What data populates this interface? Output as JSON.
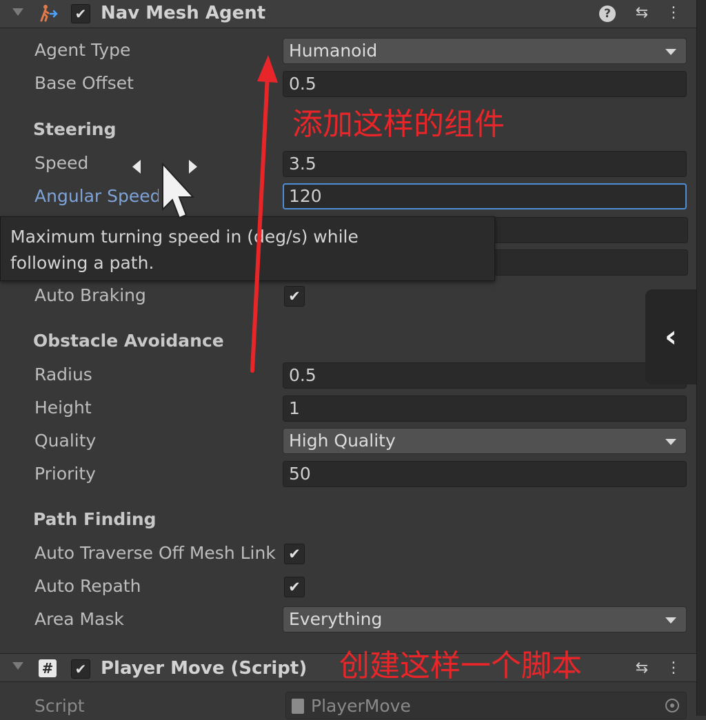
{
  "nav_mesh_agent": {
    "title": "Nav Mesh Agent",
    "enabled_mark": "✔",
    "agent_type": {
      "label": "Agent Type",
      "value": "Humanoid"
    },
    "base_offset": {
      "label": "Base Offset",
      "value": "0.5"
    },
    "steering": {
      "header": "Steering",
      "speed": {
        "label": "Speed",
        "value": "3.5"
      },
      "angular_speed": {
        "label": "Angular Speed",
        "value": "120"
      },
      "tooltip_line1": "Maximum turning speed in (deg/s) while",
      "tooltip_line2": "following a path.",
      "auto_braking": {
        "label": "Auto Braking",
        "mark": "✔"
      }
    },
    "obstacle_avoidance": {
      "header": "Obstacle Avoidance",
      "radius": {
        "label": "Radius",
        "value": "0.5"
      },
      "height": {
        "label": "Height",
        "value": "1"
      },
      "quality": {
        "label": "Quality",
        "value": "High Quality"
      },
      "priority": {
        "label": "Priority",
        "value": "50"
      }
    },
    "path_finding": {
      "header": "Path Finding",
      "auto_traverse": {
        "label": "Auto Traverse Off Mesh Link",
        "mark": "✔"
      },
      "auto_repath": {
        "label": "Auto Repath",
        "mark": "✔"
      },
      "area_mask": {
        "label": "Area Mask",
        "value": "Everything"
      }
    }
  },
  "player_move": {
    "title": "Player Move (Script)",
    "enabled_mark": "✔",
    "script_icon_glyph": "#",
    "script": {
      "label": "Script",
      "value": "PlayerMove"
    }
  },
  "header_buttons": {
    "help": "?",
    "presets": "⇆",
    "menu": "⋮"
  },
  "side_collapse_glyph": "‹",
  "annotations": {
    "add_component": "添加这样的组件",
    "create_script": "创建这样一个脚本",
    "color": "#e8262a"
  },
  "icons": [
    "nav-mesh-agent-icon",
    "checkbox-check-icon",
    "help-icon",
    "presets-icon",
    "kebab-menu-icon",
    "dropdown-caret-icon",
    "mouse-cursor-icon",
    "script-file-icon",
    "object-picker-icon",
    "chevron-left-icon"
  ]
}
